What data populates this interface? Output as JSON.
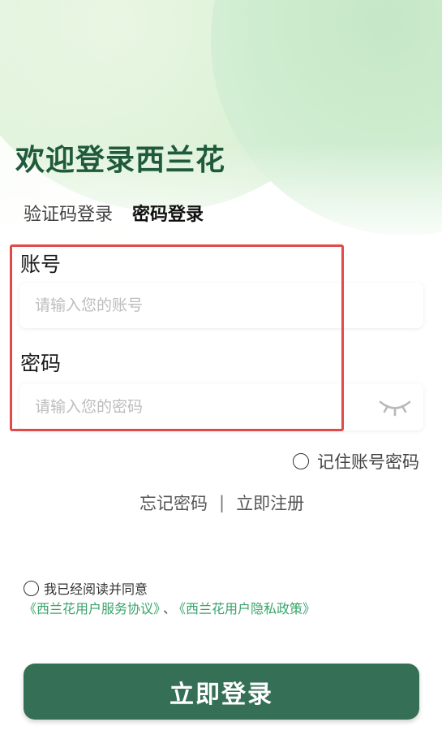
{
  "header": {
    "title": "欢迎登录西兰花"
  },
  "tabs": {
    "sms_login": "验证码登录",
    "password_login": "密码登录"
  },
  "form": {
    "account_label": "账号",
    "account_placeholder": "请输入您的账号",
    "account_value": "",
    "password_label": "密码",
    "password_placeholder": "请输入您的密码",
    "password_value": "",
    "password_visibility_icon": "eye-closed-icon"
  },
  "remember": {
    "label": "记住账号密码",
    "checked": false
  },
  "links": {
    "forgot": "忘记密码",
    "separator": "|",
    "register": "立即注册"
  },
  "agreement": {
    "text": "我已经阅读并同意",
    "service_link": "《西兰花用户服务协议》",
    "connector": "、",
    "privacy_link": "《西兰花用户隐私政策》",
    "checked": false
  },
  "submit": {
    "label": "立即登录"
  },
  "colors": {
    "brand": "#356f56",
    "title": "#1f5a3c",
    "link": "#3aa46b",
    "highlight": "#e14a4a"
  }
}
